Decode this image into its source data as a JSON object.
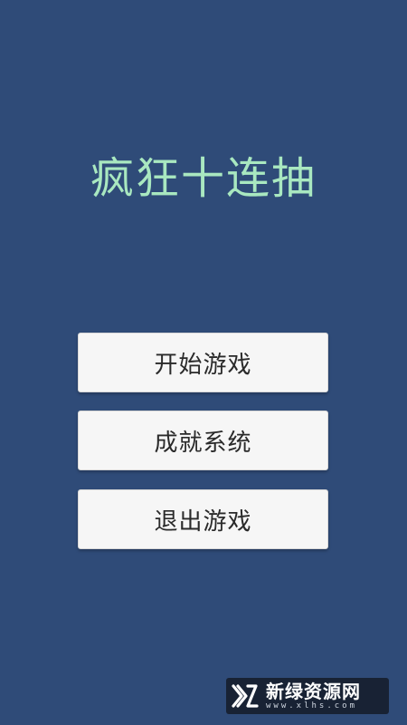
{
  "game": {
    "title": "疯狂十连抽"
  },
  "menu": {
    "start_label": "开始游戏",
    "achievements_label": "成就系统",
    "exit_label": "退出游戏"
  },
  "watermark": {
    "name": "新绿资源网",
    "url": "www.xlhs.com",
    "icon": "xl-logo-icon"
  },
  "colors": {
    "background": "#2f4b78",
    "title": "#a9e8c0",
    "button_bg": "#f6f6f6",
    "button_text": "#2a2a2a"
  }
}
